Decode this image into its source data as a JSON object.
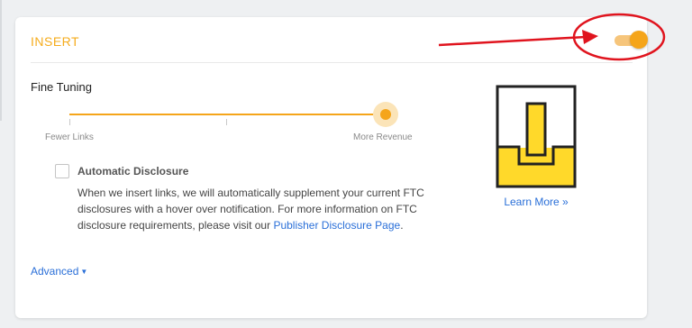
{
  "section": {
    "title": "INSERT",
    "toggle_state": "on"
  },
  "fine_tuning": {
    "label": "Fine Tuning",
    "min_label": "Fewer Links",
    "max_label": "More Revenue",
    "level": 1.0
  },
  "disclosure": {
    "checked": false,
    "title": "Automatic Disclosure",
    "text_before": "When we insert links, we will automatically supplement your current FTC disclosures with a hover over notification. For more information on FTC disclosure requirements, please visit our ",
    "link_text": "Publisher Disclosure Page",
    "text_after": "."
  },
  "advanced": {
    "label": "Advanced"
  },
  "promo": {
    "logo_icon": "bracket-logo-icon",
    "learn_more": "Learn More »"
  },
  "colors": {
    "accent": "#f5a51a",
    "title": "#f5ac1d",
    "link": "#2a6fd8",
    "annotation": "#e0141e",
    "logo_yellow": "#ffd92a"
  }
}
